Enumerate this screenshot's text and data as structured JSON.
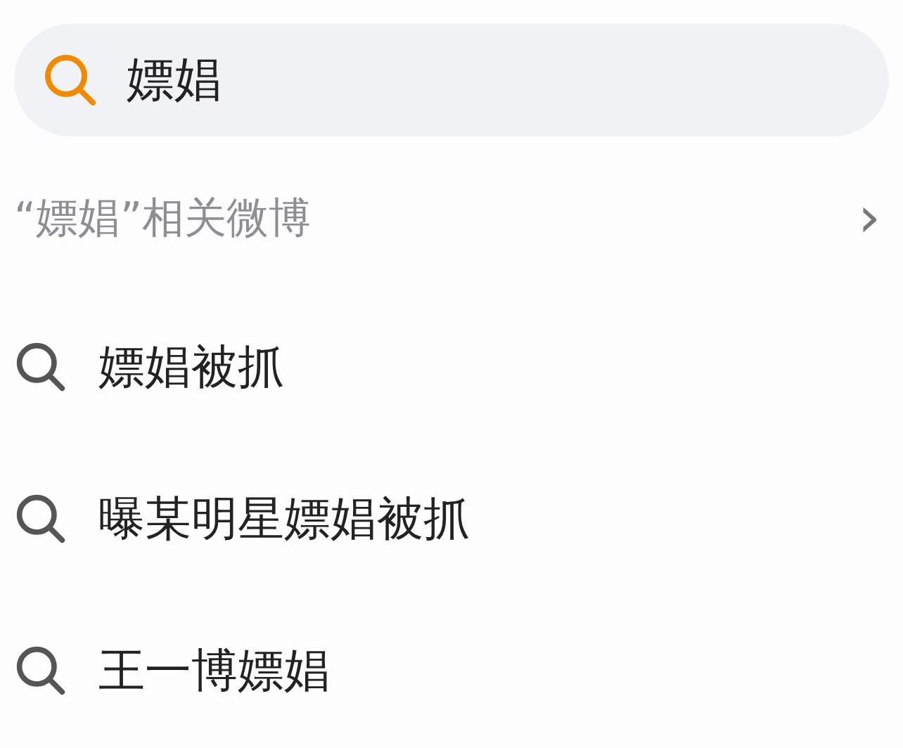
{
  "search": {
    "value": "嫖娼"
  },
  "related": {
    "label": "“嫖娼”相关微博",
    "chevron": "›"
  },
  "suggestions": [
    {
      "text": "嫖娼被抓"
    },
    {
      "text": "曝某明星嫖娼被抓"
    },
    {
      "text": "王一博嫖娼"
    }
  ]
}
